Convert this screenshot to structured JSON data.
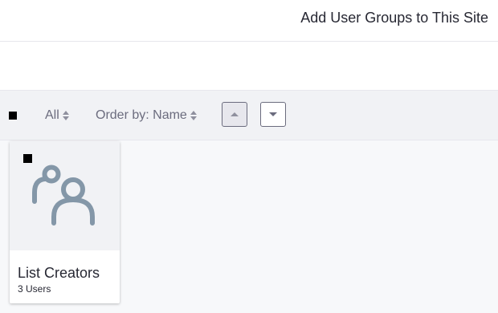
{
  "header": {
    "title": "Add User Groups to This Site"
  },
  "toolbar": {
    "filter_label": "All",
    "order_label": "Order by: Name"
  },
  "cards": [
    {
      "title": "List Creators",
      "subtitle": "3 Users",
      "icon": "user-group-icon"
    }
  ],
  "colors": {
    "icon_color": "#8497a8",
    "toolbar_bg": "#f1f2f5",
    "text_secondary": "#6b6c7e"
  }
}
